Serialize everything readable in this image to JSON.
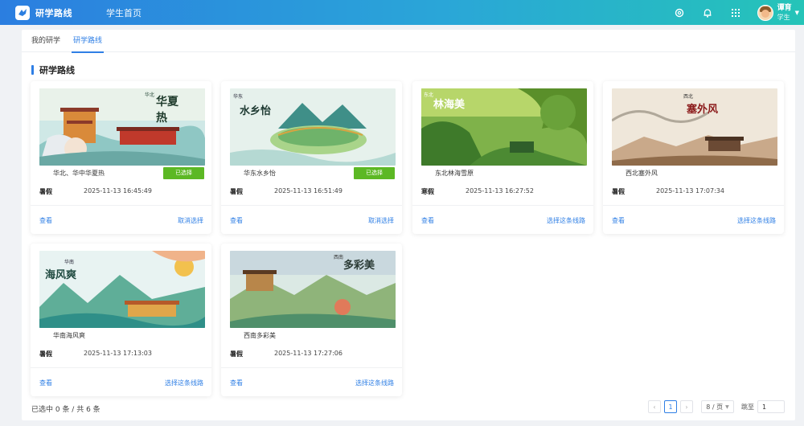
{
  "app": {
    "title": "研学路线",
    "nav_home": "学生首页"
  },
  "user": {
    "name": "谭育",
    "role": "学生"
  },
  "tabs": [
    {
      "label": "我的研学",
      "active": false
    },
    {
      "label": "研学路线",
      "active": true
    }
  ],
  "section_title": "研学路线",
  "routes": [
    {
      "name": "华北、华中华夏热",
      "season": "暑假",
      "time": "2025-11-13 16:45:49",
      "tag": "已选择",
      "view": "查看",
      "action": "取消选择",
      "selected": true
    },
    {
      "name": "华东水乡怡",
      "season": "暑假",
      "time": "2025-11-13 16:51:49",
      "tag": "已选择",
      "view": "查看",
      "action": "取消选择",
      "selected": true
    },
    {
      "name": "东北林海雪原",
      "season": "寒假",
      "time": "2025-11-13 16:27:52",
      "tag": "",
      "view": "查看",
      "action": "选择这条线路",
      "selected": false
    },
    {
      "name": "西北塞外风",
      "season": "暑假",
      "time": "2025-11-13 17:07:34",
      "tag": "",
      "view": "查看",
      "action": "选择这条线路",
      "selected": false
    },
    {
      "name": "华南海风爽",
      "season": "暑假",
      "time": "2025-11-13 17:13:03",
      "tag": "",
      "view": "查看",
      "action": "选择这条线路",
      "selected": false
    },
    {
      "name": "西南多彩美",
      "season": "暑假",
      "time": "2025-11-13 17:27:06",
      "tag": "",
      "view": "查看",
      "action": "选择这条线路",
      "selected": false
    }
  ],
  "poster_text": [
    {
      "region": "华北",
      "title": "华夏热"
    },
    {
      "region": "华东",
      "title": "水乡怡"
    },
    {
      "region": "东北",
      "title": "林海美"
    },
    {
      "region": "西北",
      "title": "塞外风"
    },
    {
      "region": "华南",
      "title": "海风爽"
    },
    {
      "region": "西南",
      "title": "多彩美"
    }
  ],
  "footer": {
    "selection_summary": "已选中 0 条 / 共 6 条"
  },
  "pagination": {
    "current_page": "1",
    "page_size": "8 / 页",
    "jump_label": "跳至",
    "jump_value": "1",
    "prev": "‹",
    "next": "›"
  },
  "colors": {
    "accent": "#2f7fe5",
    "selected_tag": "#5cb824"
  },
  "icons": [
    "logo-icon",
    "settings-icon",
    "bell-icon",
    "apps-grid-icon",
    "avatar",
    "chevron-down-icon"
  ]
}
